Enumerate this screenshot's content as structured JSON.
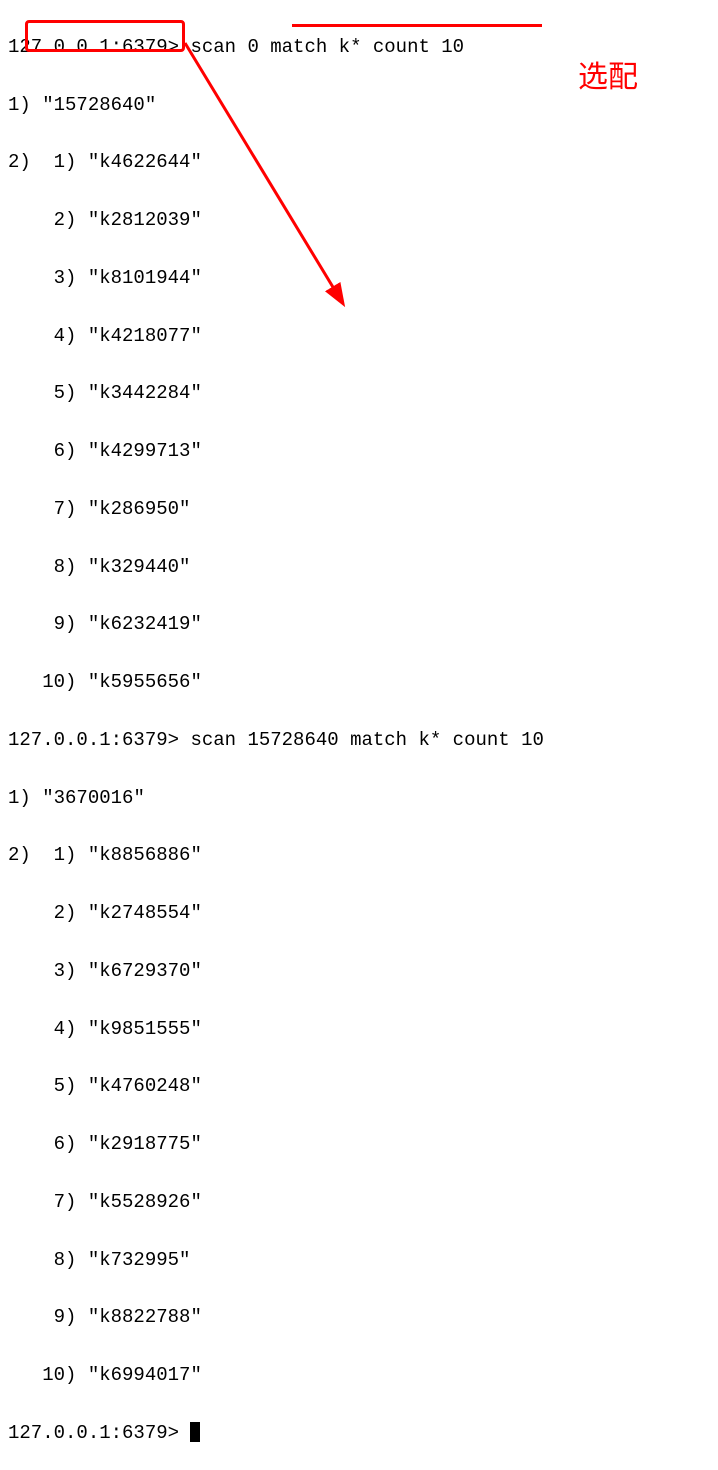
{
  "prompt_prefix": "127.0.0.1:6379>",
  "scan1": {
    "command": "scan 0 match k* count 10",
    "cursor_out": "15728640",
    "items": [
      "k4622644",
      "k2812039",
      "k8101944",
      "k4218077",
      "k3442284",
      "k4299713",
      "k286950",
      "k329440",
      "k6232419",
      "k5955656"
    ]
  },
  "scan2": {
    "command": "scan 15728640 match k* count 10",
    "cursor_out": "3670016",
    "items": [
      "k8856886",
      "k2748554",
      "k6729370",
      "k9851555",
      "k4760248",
      "k2918775",
      "k5528926",
      "k732995",
      "k8822788",
      "k6994017"
    ]
  },
  "annotation_label": "选配",
  "colors": {
    "annotation": "#ff0000",
    "text": "#000000",
    "background": "#ffffff"
  }
}
